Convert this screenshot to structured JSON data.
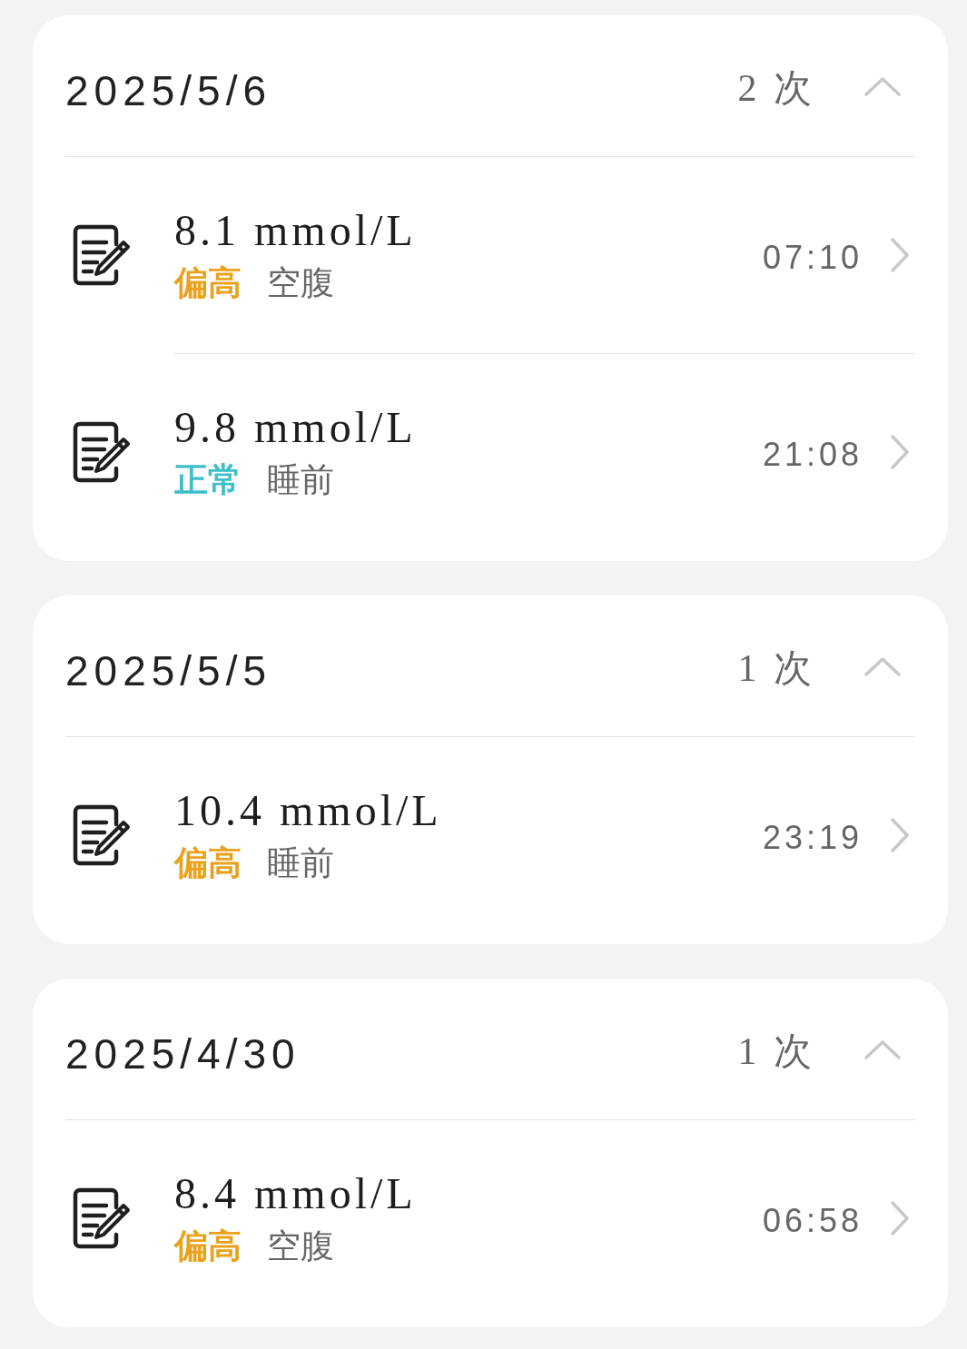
{
  "days": [
    {
      "date": "2025/5/6",
      "count": "2 次",
      "expanded": true,
      "records": [
        {
          "value": "8.1 mmol/L",
          "status": {
            "label": "偏高",
            "color": "#eaa21e"
          },
          "period": "空腹",
          "time": "07:10"
        },
        {
          "value": "9.8 mmol/L",
          "status": {
            "label": "正常",
            "color": "#3fbfca"
          },
          "period": "睡前",
          "time": "21:08"
        }
      ]
    },
    {
      "date": "2025/5/5",
      "count": "1 次",
      "expanded": true,
      "records": [
        {
          "value": "10.4 mmol/L",
          "status": {
            "label": "偏高",
            "color": "#eaa21e"
          },
          "period": "睡前",
          "time": "23:19"
        }
      ]
    },
    {
      "date": "2025/4/30",
      "count": "1 次",
      "expanded": true,
      "records": [
        {
          "value": "8.4 mmol/L",
          "status": {
            "label": "偏高",
            "color": "#eaa21e"
          },
          "period": "空腹",
          "time": "06:58"
        }
      ]
    }
  ]
}
